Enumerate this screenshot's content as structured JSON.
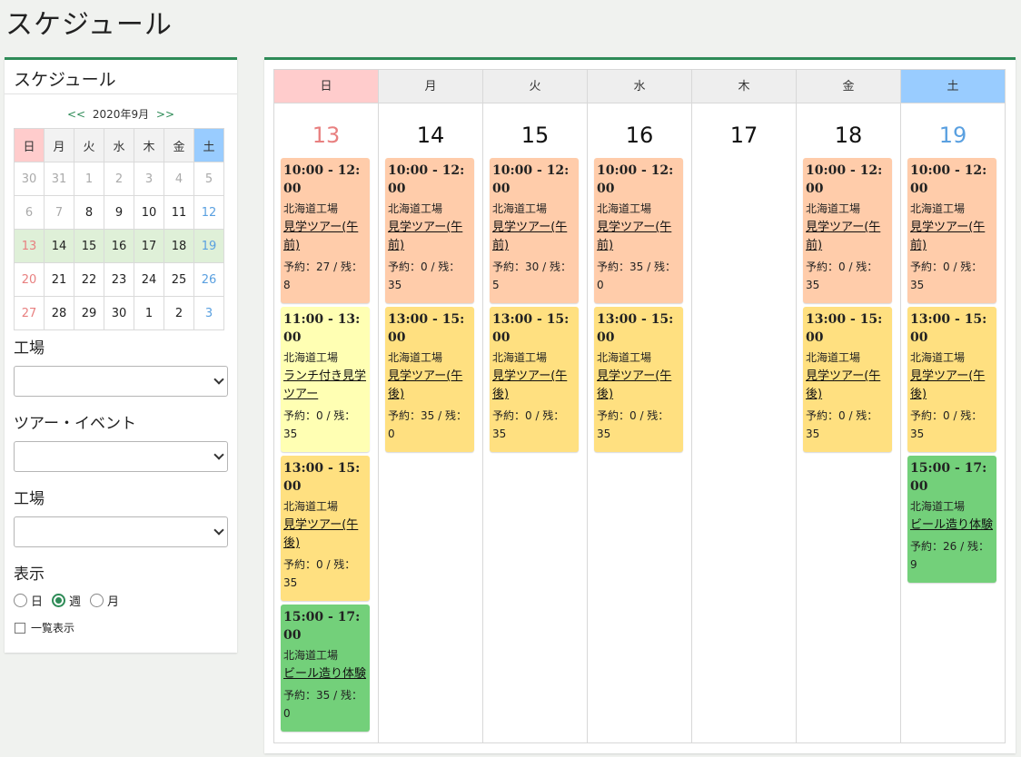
{
  "page_title": "スケジュール",
  "sidebar": {
    "title": "スケジュール",
    "prev": "<<",
    "next": ">>",
    "month_label": "2020年9月",
    "weekdays": [
      "日",
      "月",
      "火",
      "水",
      "木",
      "金",
      "土"
    ],
    "weeks": [
      [
        "30",
        "31",
        "1",
        "2",
        "3",
        "4",
        "5"
      ],
      [
        "6",
        "7",
        "8",
        "9",
        "10",
        "11",
        "12"
      ],
      [
        "13",
        "14",
        "15",
        "16",
        "17",
        "18",
        "19"
      ],
      [
        "20",
        "21",
        "22",
        "23",
        "24",
        "25",
        "26"
      ],
      [
        "27",
        "28",
        "29",
        "30",
        "1",
        "2",
        "3"
      ]
    ],
    "factory_label": "工場",
    "tour_label": "ツアー・イベント",
    "factory2_label": "工場",
    "view_label": "表示",
    "view_options": [
      "日",
      "週",
      "月"
    ],
    "view_selected": "週",
    "list_label": "一覧表示"
  },
  "week": {
    "days": [
      {
        "head": "日",
        "num": "13",
        "events": [
          {
            "time": "10:00 - 12:00",
            "place": "北海道工場",
            "tour": "見学ツアー(午前)",
            "stat": "予約：27 / 残：8",
            "kind": "am"
          },
          {
            "time": "11:00 - 13:00",
            "place": "北海道工場",
            "tour": "ランチ付き見学ツアー",
            "stat": "予約：0 / 残：35",
            "kind": "lunch"
          },
          {
            "time": "13:00 - 15:00",
            "place": "北海道工場",
            "tour": "見学ツアー(午後)",
            "stat": "予約：0 / 残：35",
            "kind": "pm"
          },
          {
            "time": "15:00 - 17:00",
            "place": "北海道工場",
            "tour": "ビール造り体験",
            "stat": "予約：35 / 残：0",
            "kind": "beer"
          }
        ]
      },
      {
        "head": "月",
        "num": "14",
        "events": [
          {
            "time": "10:00 - 12:00",
            "place": "北海道工場",
            "tour": "見学ツアー(午前)",
            "stat": "予約：0 / 残：35",
            "kind": "am"
          },
          {
            "time": "13:00 - 15:00",
            "place": "北海道工場",
            "tour": "見学ツアー(午後)",
            "stat": "予約：35 / 残：0",
            "kind": "pm"
          }
        ]
      },
      {
        "head": "火",
        "num": "15",
        "events": [
          {
            "time": "10:00 - 12:00",
            "place": "北海道工場",
            "tour": "見学ツアー(午前)",
            "stat": "予約：30 / 残：5",
            "kind": "am"
          },
          {
            "time": "13:00 - 15:00",
            "place": "北海道工場",
            "tour": "見学ツアー(午後)",
            "stat": "予約：0 / 残：35",
            "kind": "pm"
          }
        ]
      },
      {
        "head": "水",
        "num": "16",
        "events": [
          {
            "time": "10:00 - 12:00",
            "place": "北海道工場",
            "tour": "見学ツアー(午前)",
            "stat": "予約：35 / 残：0",
            "kind": "am"
          },
          {
            "time": "13:00 - 15:00",
            "place": "北海道工場",
            "tour": "見学ツアー(午後)",
            "stat": "予約：0 / 残：35",
            "kind": "pm"
          }
        ]
      },
      {
        "head": "木",
        "num": "17",
        "events": []
      },
      {
        "head": "金",
        "num": "18",
        "events": [
          {
            "time": "10:00 - 12:00",
            "place": "北海道工場",
            "tour": "見学ツアー(午前)",
            "stat": "予約：0 / 残：35",
            "kind": "am"
          },
          {
            "time": "13:00 - 15:00",
            "place": "北海道工場",
            "tour": "見学ツアー(午後)",
            "stat": "予約：0 / 残：35",
            "kind": "pm"
          }
        ]
      },
      {
        "head": "土",
        "num": "19",
        "events": [
          {
            "time": "10:00 - 12:00",
            "place": "北海道工場",
            "tour": "見学ツアー(午前)",
            "stat": "予約：0 / 残：35",
            "kind": "am"
          },
          {
            "time": "13:00 - 15:00",
            "place": "北海道工場",
            "tour": "見学ツアー(午後)",
            "stat": "予約：0 / 残：35",
            "kind": "pm"
          },
          {
            "time": "15:00 - 17:00",
            "place": "北海道工場",
            "tour": "ビール造り体験",
            "stat": "予約：26 / 残：9",
            "kind": "beer"
          }
        ]
      }
    ]
  }
}
